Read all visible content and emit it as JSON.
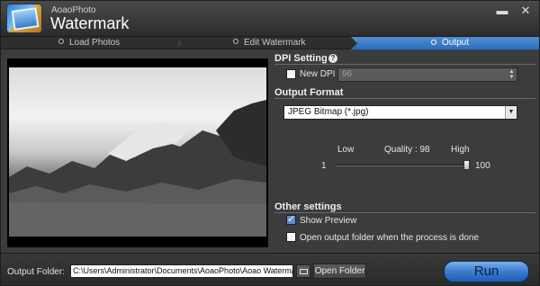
{
  "app": {
    "name_small": "AoaoPhoto",
    "name_big": "Watermark"
  },
  "window": {
    "minimize_glyph": "▬",
    "close_glyph": "✕"
  },
  "steps": [
    {
      "label": "Load Photos"
    },
    {
      "label": "Edit Watermark"
    },
    {
      "label": "Output",
      "active": true
    }
  ],
  "dpi": {
    "title": "DPI Setting",
    "help_glyph": "?",
    "new_dpi_label": "New DPI",
    "new_dpi_checked": false,
    "value": "96"
  },
  "format": {
    "title": "Output Format",
    "selected": "JPEG Bitmap (*.jpg)"
  },
  "quality": {
    "low_label": "Low",
    "high_label": "High",
    "label": "Quality : 98",
    "min": "1",
    "max": "100",
    "value": 98
  },
  "other": {
    "title": "Other settings",
    "show_preview_label": "Show Preview",
    "show_preview_checked": true,
    "open_folder_label": "Open output folder when the process is done",
    "open_folder_checked": false
  },
  "footer": {
    "output_folder_label": "Output Folder:",
    "output_folder_path": "C:\\Users\\Administrator\\Documents\\AoaoPhoto\\Aoao Watermark\\Output",
    "open_folder_button": "Open Folder",
    "run_button": "Run"
  },
  "colors": {
    "accent": "#3a7bd0",
    "background": "#3c3c3c"
  },
  "icons": [
    "app-logo-icon",
    "help-icon",
    "folder-icon"
  ]
}
